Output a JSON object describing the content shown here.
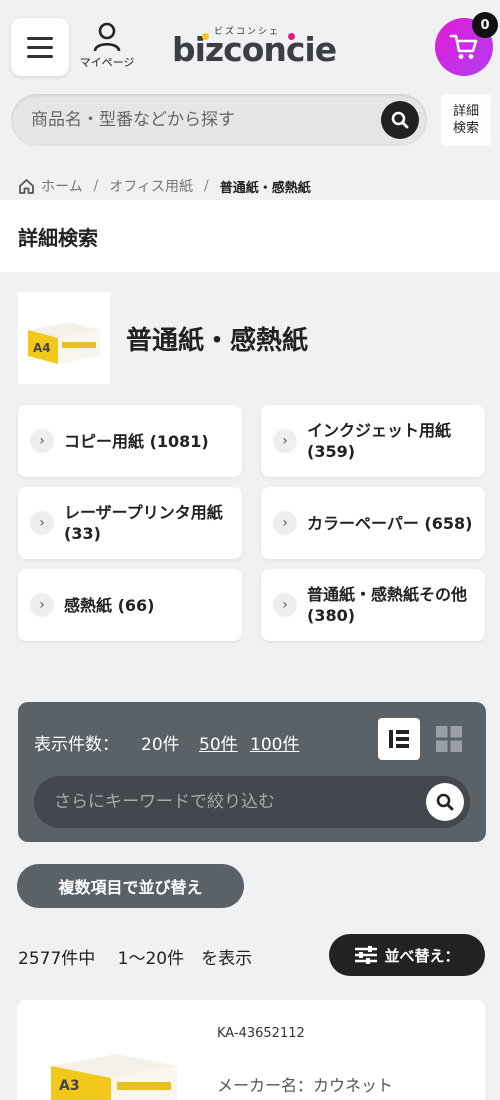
{
  "header": {
    "mypage_label": "マイページ",
    "logo_kana": "ビズコンシェ",
    "logo_text": "bizconcie",
    "cart_count": "0",
    "brand_gradient": [
      "#e21bd7",
      "#b13df2"
    ]
  },
  "search": {
    "placeholder": "商品名・型番などから探す",
    "advanced_label_1": "詳細",
    "advanced_label_2": "検索"
  },
  "breadcrumb": {
    "home": "ホーム",
    "parent": "オフィス用紙",
    "current": "普通紙・感熱紙"
  },
  "section": {
    "advanced_search_title": "詳細検索",
    "category_title": "普通紙・感熱紙",
    "category_image_label": "A4"
  },
  "categories": [
    {
      "label": "コピー用紙 (1081)"
    },
    {
      "label": "インクジェット用紙 (359)"
    },
    {
      "label": "レーザープリンタ用紙 (33)"
    },
    {
      "label": "カラーペーパー (658)"
    },
    {
      "label": "感熱紙 (66)"
    },
    {
      "label": "普通紙・感熱紙その他 (380)"
    }
  ],
  "display": {
    "label": "表示件数：",
    "options": [
      "20件",
      "50件",
      "100件"
    ],
    "keyword_placeholder": "さらにキーワードで絞り込む"
  },
  "multi_sort_label": "複数項目で並び替え",
  "result": {
    "total": "2577件中",
    "range": "1〜20件",
    "suffix": "を表示"
  },
  "sort_label": "並べ替え：",
  "product": {
    "code": "KA-43652112",
    "maker": "メーカー名：カウネット",
    "image_label": "A3"
  }
}
